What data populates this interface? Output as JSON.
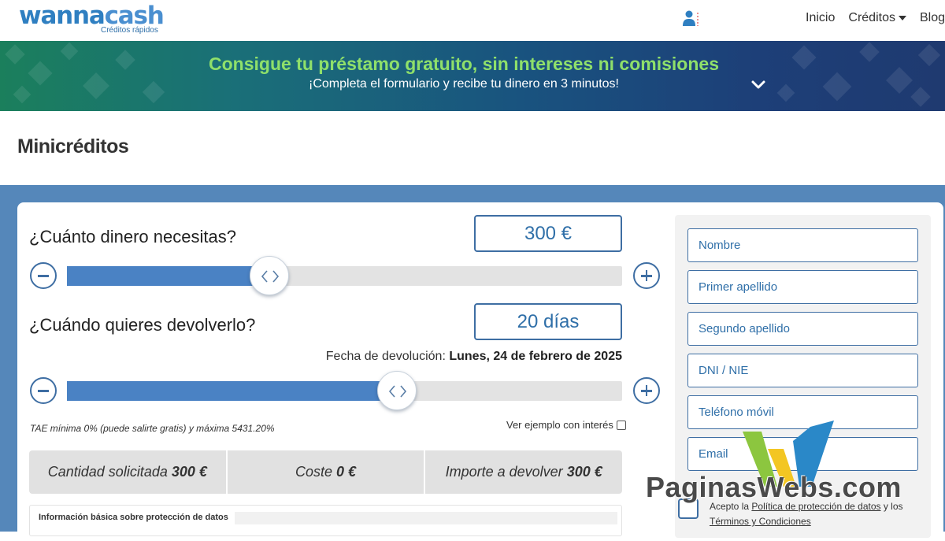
{
  "header": {
    "logo_word_1": "wanna",
    "logo_word_2": "cash",
    "logo_tagline": "Créditos rápidos",
    "nav": [
      {
        "label": "Inicio"
      },
      {
        "label": "Créditos"
      },
      {
        "label": "Blog"
      }
    ]
  },
  "banner": {
    "title": "Consigue tu préstamo gratuito, sin intereses ni comisiones",
    "subtitle": "¡Completa el formulario y recibe tu dinero en 3 minutos!"
  },
  "page": {
    "title": "Minicréditos"
  },
  "calculator": {
    "amount": {
      "label": "¿Cuánto dinero necesitas?",
      "value": "300 €",
      "slider_fraction": 0.364
    },
    "term": {
      "label": "¿Cuándo quieres devolverlo?",
      "value": "20 días",
      "slider_fraction": 0.595
    },
    "due_date_label": "Fecha de devolución:",
    "due_date_value": "Lunes, 24 de febrero de 2025",
    "tae_note": "TAE mínima 0% (puede salirte gratis) y máxima 5431.20%",
    "example_label": "Ver ejemplo con interés",
    "summary": [
      {
        "label": "Cantidad solicitada",
        "value": "300 €"
      },
      {
        "label": "Coste",
        "value": "0 €"
      },
      {
        "label": "Importe a devolver",
        "value": "300 €"
      }
    ],
    "privacy_title": "Información básica sobre protección de datos"
  },
  "form": {
    "fields": [
      {
        "placeholder": "Nombre"
      },
      {
        "placeholder": "Primer apellido"
      },
      {
        "placeholder": "Segundo apellido"
      },
      {
        "placeholder": "DNI / NIE"
      },
      {
        "placeholder": "Teléfono móvil"
      },
      {
        "placeholder": "Email"
      }
    ],
    "accept_prefix": "Acepto la",
    "privacy_link": "Política de protección de datos",
    "accept_middle": "y los",
    "terms_link": "Términos y Condiciones"
  },
  "watermark": {
    "text": "PaginasWebs.com"
  },
  "colors": {
    "primary_blue": "#3e6ea3",
    "slider_fill": "#4a82c4",
    "banner_title_green": "#8fe06a",
    "section_blue": "#5587ba"
  }
}
